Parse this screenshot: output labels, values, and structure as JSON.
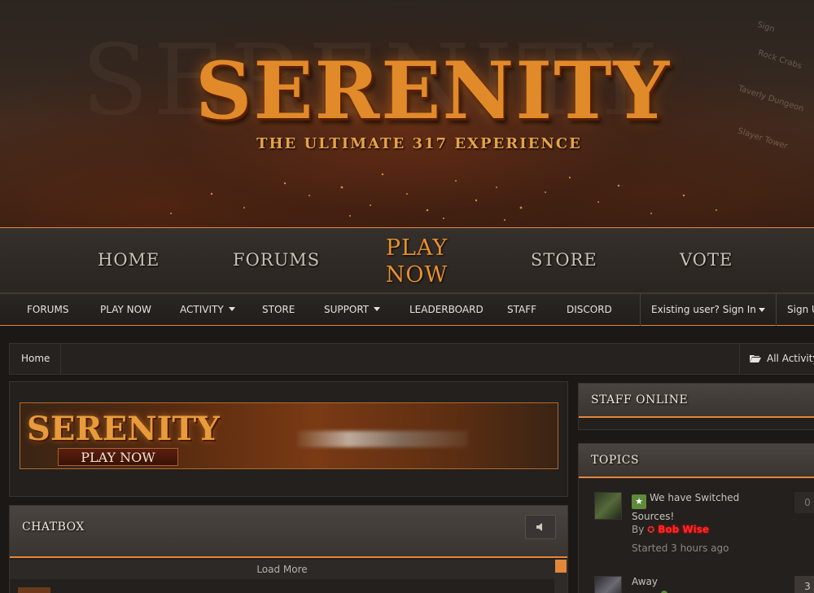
{
  "hero": {
    "logo": "SERENITY",
    "tagline": "THE ULTIMATE 317 EXPERIENCE",
    "map_labels": [
      "Rock Crabs",
      "Taverly Dungeon",
      "Slayer Tower",
      "Sign"
    ]
  },
  "main_nav": {
    "items": [
      {
        "label": "HOME"
      },
      {
        "label": "FORUMS"
      },
      {
        "label": "PLAY NOW",
        "active": true
      },
      {
        "label": "STORE"
      },
      {
        "label": "VOTE"
      }
    ]
  },
  "sub_nav": {
    "items": [
      {
        "label": "FORUMS"
      },
      {
        "label": "PLAY NOW"
      },
      {
        "label": "ACTIVITY",
        "dropdown": true
      },
      {
        "label": "STORE"
      },
      {
        "label": "SUPPORT",
        "dropdown": true
      },
      {
        "label": "LEADERBOARD"
      },
      {
        "label": "STAFF"
      },
      {
        "label": "DISCORD"
      }
    ],
    "signin": "Existing user? Sign In",
    "signup": "Sign U"
  },
  "breadcrumb": {
    "home": "Home",
    "all_activity": "All Activity"
  },
  "banner": {
    "logo": "SERENITY",
    "button": "PLAY NOW"
  },
  "chatbox": {
    "title": "CHATBOX",
    "load_more": "Load More"
  },
  "staff_online": {
    "title": "STAFF ONLINE"
  },
  "topics": {
    "title": "TOPICS",
    "items": [
      {
        "title": "We have Switched Sources!",
        "by": "By",
        "author": "Bob Wise",
        "started": "Started 3 hours ago",
        "replies": "0",
        "pinned": true
      },
      {
        "title": "Away",
        "replies": "3"
      }
    ]
  },
  "colors": {
    "accent": "#e3873b",
    "background": "#1b1816",
    "panel": "#23201d",
    "staff_name": "#ff2a2a"
  }
}
